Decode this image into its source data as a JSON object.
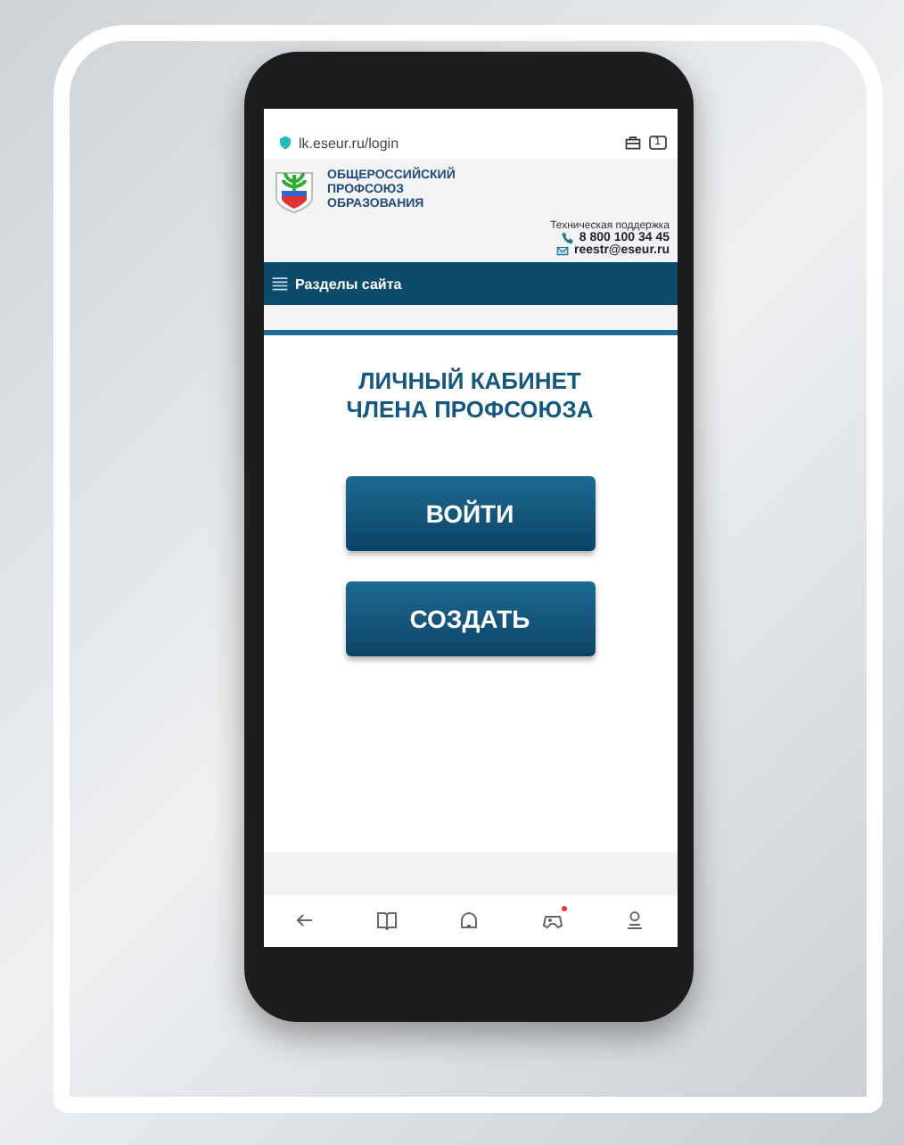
{
  "browser": {
    "url": "lk.eseur.ru/login",
    "tab_count": "1"
  },
  "header": {
    "org_name": "ОБЩЕРОССИЙСКИЙ ПРОФСОЮЗ ОБРАЗОВАНИЯ",
    "support_label": "Техническая поддержка",
    "phone": "8 800 100 34 45",
    "email": "reestr@eseur.ru"
  },
  "nav": {
    "label": "Разделы сайта"
  },
  "title": "ЛИЧНЫЙ КАБИНЕТ ЧЛЕНА ПРОФСОЮЗА",
  "buttons": [
    "ВОЙТИ",
    "СОЗДАТЬ"
  ],
  "bottom_nav": [
    {
      "kind": "back",
      "badge": false
    },
    {
      "kind": "book",
      "badge": false
    },
    {
      "kind": "home",
      "badge": false
    },
    {
      "kind": "games",
      "badge": true
    },
    {
      "kind": "profile",
      "badge": false
    }
  ]
}
